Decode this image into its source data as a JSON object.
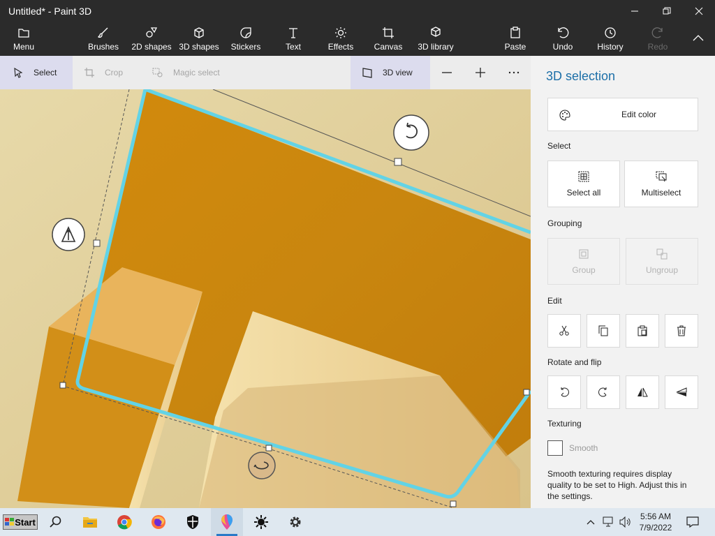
{
  "window": {
    "title": "Untitled* - Paint 3D"
  },
  "ribbon": {
    "menu": "Menu",
    "brushes": "Brushes",
    "shapes2d": "2D shapes",
    "shapes3d": "3D shapes",
    "stickers": "Stickers",
    "text": "Text",
    "effects": "Effects",
    "canvas": "Canvas",
    "library3d": "3D library",
    "paste": "Paste",
    "undo": "Undo",
    "history": "History",
    "redo": "Redo"
  },
  "toolbar": {
    "select": "Select",
    "crop": "Crop",
    "magic_select": "Magic select",
    "view3d": "3D view"
  },
  "panel": {
    "title": "3D selection",
    "edit_color": "Edit color",
    "select_heading": "Select",
    "select_all": "Select all",
    "multiselect": "Multiselect",
    "grouping_heading": "Grouping",
    "group": "Group",
    "ungroup": "Ungroup",
    "edit_heading": "Edit",
    "rotate_heading": "Rotate and flip",
    "texturing_heading": "Texturing",
    "smooth": "Smooth",
    "note": "Smooth texturing requires display quality to be set to High. Adjust this in the settings."
  },
  "taskbar": {
    "start": "Start",
    "time": "5:56 AM",
    "date": "7/9/2022"
  },
  "colors": {
    "accent": "#1c6fa8",
    "selection": "#62d3e6",
    "object": "#d08a10"
  }
}
